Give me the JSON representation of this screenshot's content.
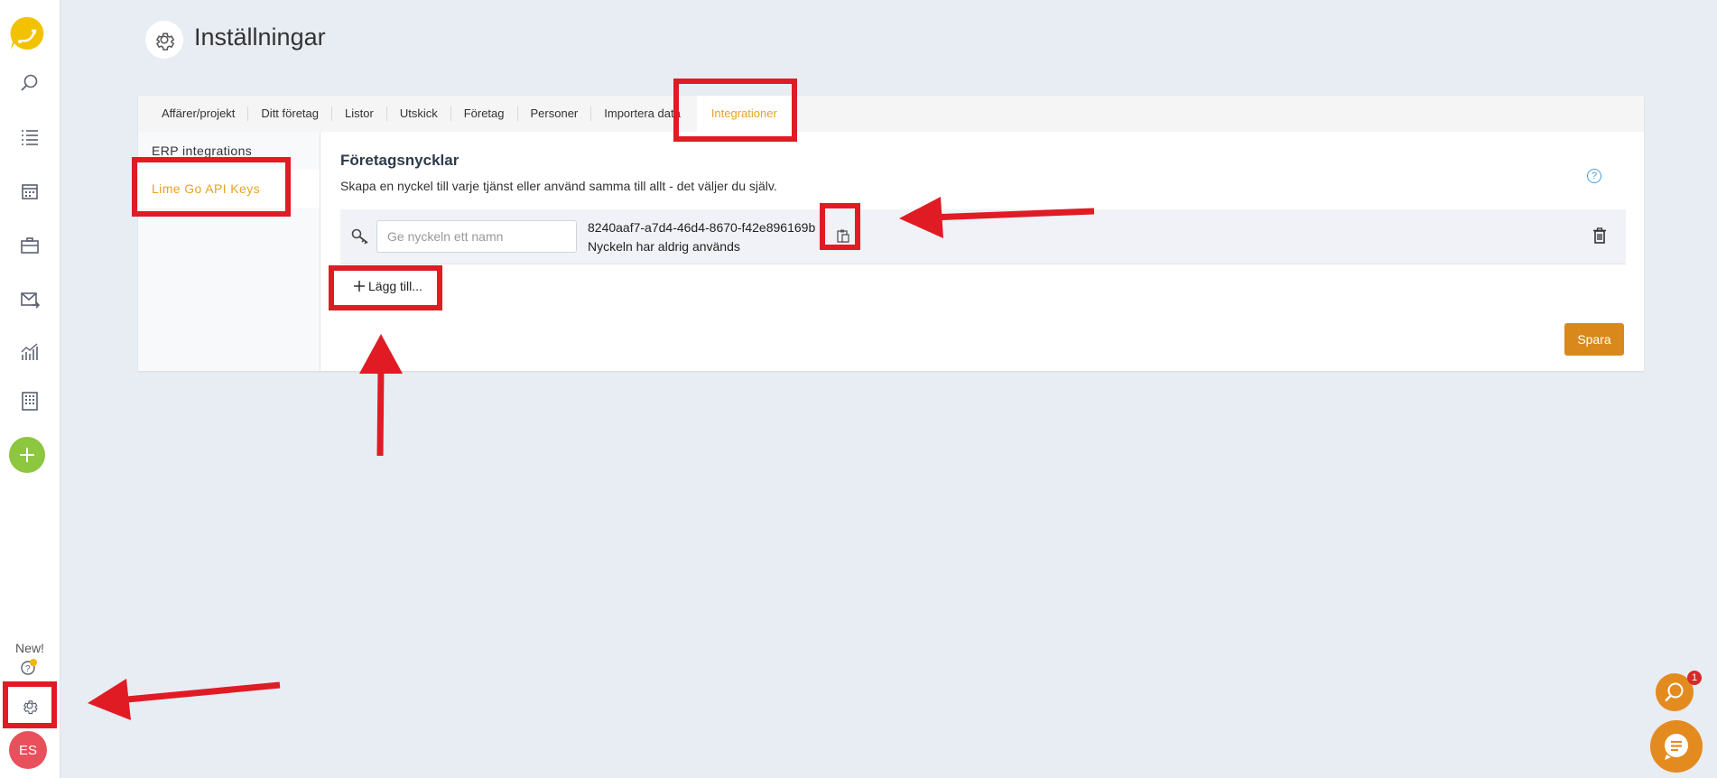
{
  "header": {
    "title": "Inställningar"
  },
  "tabs": [
    {
      "label": "Affärer/projekt"
    },
    {
      "label": "Ditt företag"
    },
    {
      "label": "Listor"
    },
    {
      "label": "Utskick"
    },
    {
      "label": "Företag"
    },
    {
      "label": "Personer"
    },
    {
      "label": "Importera data"
    },
    {
      "label": "Integrationer",
      "active": true
    }
  ],
  "sidebar": {
    "items": [
      {
        "label": "ERP integrations"
      },
      {
        "label": "Lime Go API Keys",
        "active": true
      }
    ],
    "new_label": "New!",
    "avatar_initials": "ES"
  },
  "main": {
    "title": "Företagsnycklar",
    "description": "Skapa en nyckel till varje tjänst eller använd samma till allt - det väljer du själv.",
    "key": {
      "name_placeholder": "Ge nyckeln ett namn",
      "value": "8240aaf7-a7d4-46d4-8670-f42e896169b",
      "usage": "Nyckeln har aldrig används"
    },
    "add_label": "Lägg till...",
    "save_label": "Spara"
  },
  "floating": {
    "badge_count": "1"
  },
  "colors": {
    "accent": "#e8a320",
    "primary_button": "#d9891c",
    "annotation": "#e01b24",
    "add_button": "#8dc63f"
  }
}
